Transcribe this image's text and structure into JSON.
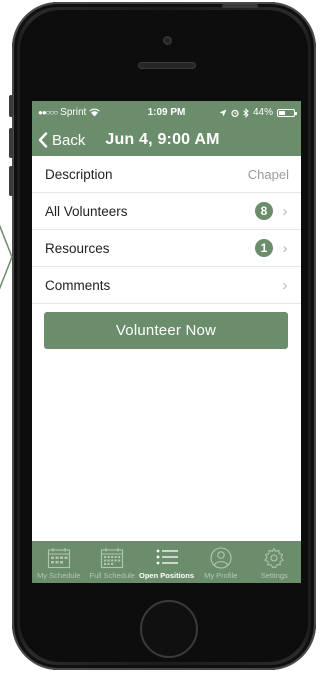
{
  "status_bar": {
    "signal": "●●○○○",
    "carrier": "Sprint",
    "time": "1:09 PM",
    "battery": "44%",
    "battery_level": 0.44
  },
  "nav": {
    "back_label": "Back",
    "title": "Jun 4, 9:00 AM"
  },
  "rows": [
    {
      "label": "Description",
      "value": "Chapel"
    },
    {
      "label": "All Volunteers",
      "badge": "8"
    },
    {
      "label": "Resources",
      "badge": "1"
    },
    {
      "label": "Comments"
    }
  ],
  "chevron": "›",
  "cta_label": "Volunteer Now",
  "tabs": [
    {
      "label": "My Schedule",
      "icon": "calendar-icon"
    },
    {
      "label": "Full Schedule",
      "icon": "calendar-grid-icon"
    },
    {
      "label": "Open Positions",
      "icon": "list-icon",
      "active": true
    },
    {
      "label": "My Profile",
      "icon": "person-icon"
    },
    {
      "label": "Settings",
      "icon": "gear-icon"
    }
  ],
  "colors": {
    "accent": "#6b8d6c",
    "tab_inactive": "#b2c7b2",
    "chevron": "#b8b8b8"
  }
}
